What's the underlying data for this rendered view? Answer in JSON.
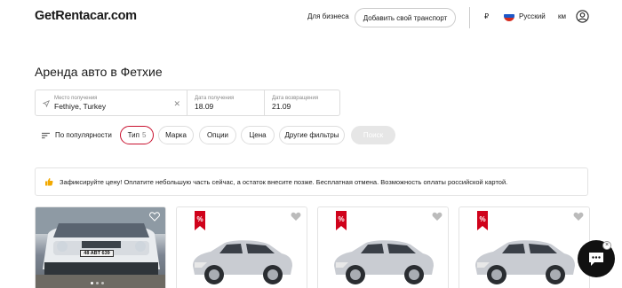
{
  "header": {
    "logo": "GetRentacar.com",
    "business_link": "Для бизнеса",
    "add_transport": "Добавить свой транспорт",
    "currency": "₽",
    "language": "Русский",
    "units": "км"
  },
  "page": {
    "title": "Аренда авто в Фетхие"
  },
  "search": {
    "location_label": "Место получения",
    "location_value": "Fethiye, Turkey",
    "pickup_label": "Дата получения",
    "pickup_value": "18.09",
    "return_label": "Дата возвращения",
    "return_value": "21.09"
  },
  "filters": {
    "sort": "По популярности",
    "type": "Тип",
    "type_count": "5",
    "brand": "Марка",
    "options": "Опции",
    "price": "Цена",
    "other": "Другие фильтры",
    "search_button": "Поиск"
  },
  "banner": {
    "text": "Зафиксируйте цену! Оплатите небольшую часть сейчас, а остаток внесите позже. Бесплатная отмена. Возможность оплаты российской картой."
  },
  "cards": [
    {
      "plate": "48 ABT 639",
      "promo": false
    },
    {
      "promo": true
    },
    {
      "promo": true
    },
    {
      "promo": true
    }
  ],
  "colors": {
    "accent_red": "#c8102e",
    "chat_bg": "#111111"
  }
}
